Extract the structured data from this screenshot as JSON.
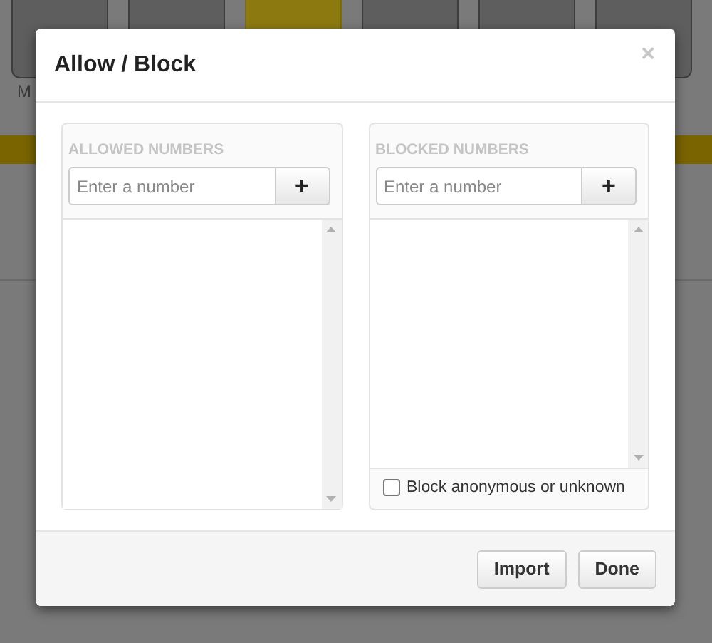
{
  "background": {
    "tiles": [
      {
        "selected": false,
        "label": "M"
      },
      {
        "selected": false
      },
      {
        "selected": true
      },
      {
        "selected": false
      },
      {
        "selected": false
      },
      {
        "selected": false
      }
    ]
  },
  "dialog": {
    "title": "Allow / Block",
    "close": "×",
    "panels": [
      {
        "heading": "ALLOWED NUMBERS",
        "placeholder": "Enter a number",
        "add": "+"
      },
      {
        "heading": "BLOCKED NUMBERS",
        "placeholder": "Enter a number",
        "add": "+",
        "option": {
          "label": "Block anonymous or unknown",
          "checked": false
        }
      }
    ],
    "buttons": [
      "Import",
      "Done"
    ]
  }
}
